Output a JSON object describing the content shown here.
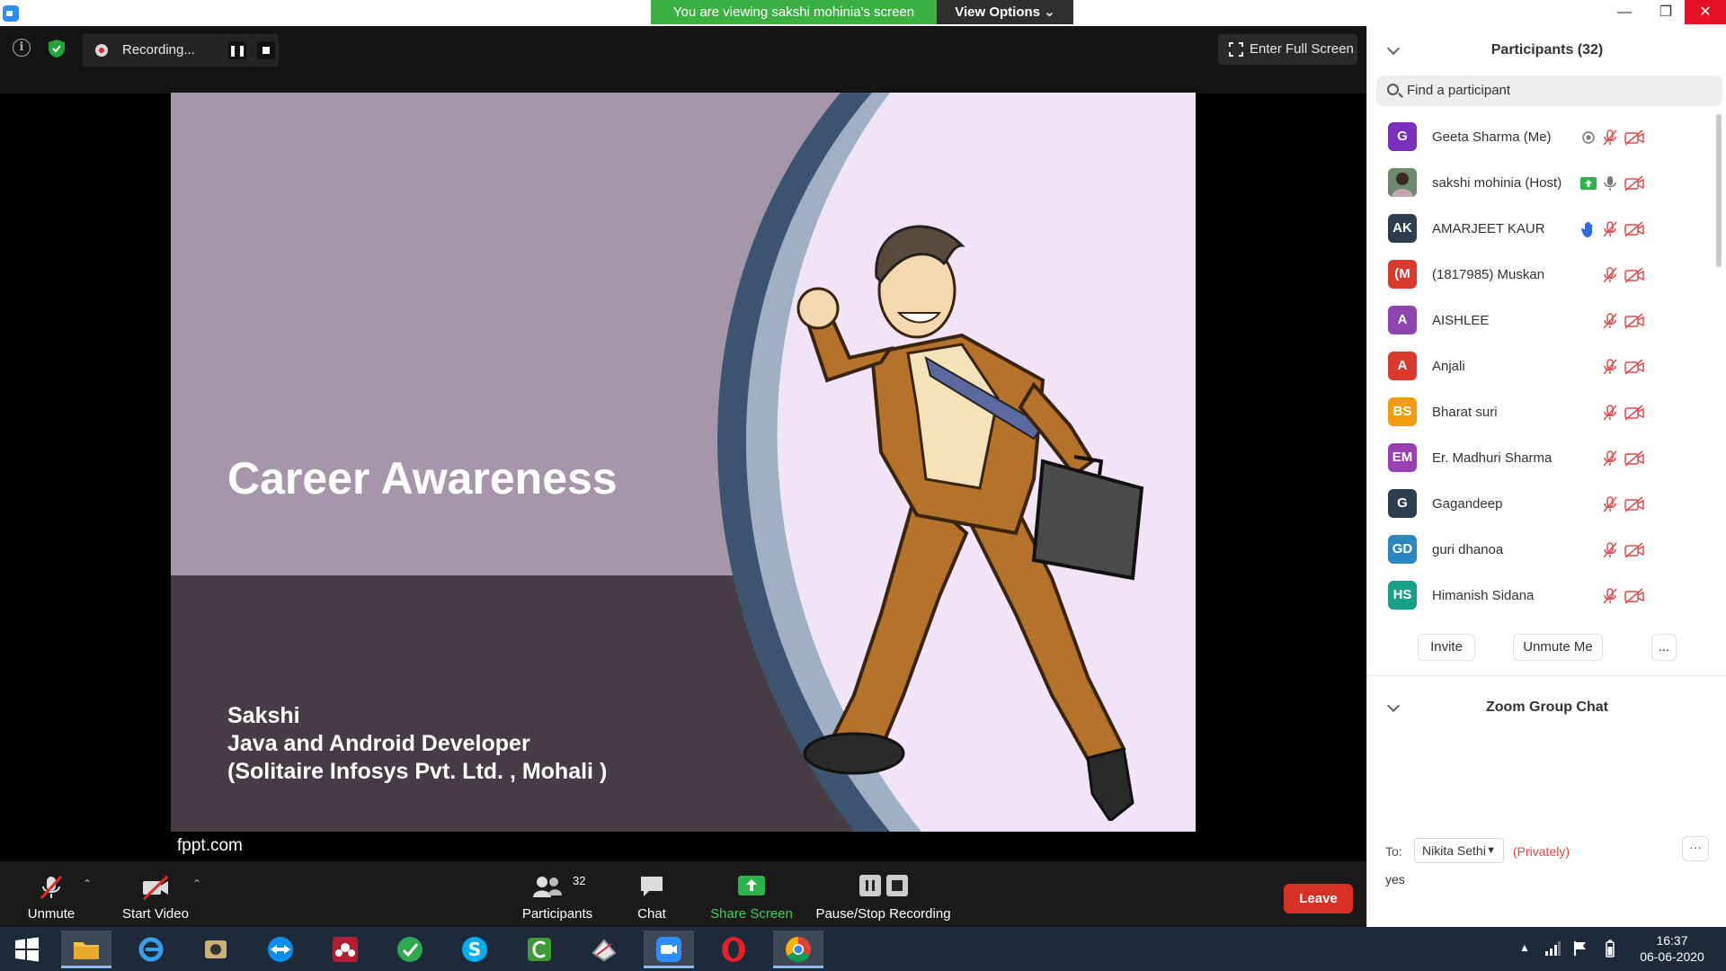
{
  "window": {
    "banner": "You are viewing sakshi mohinia's screen",
    "view_options": "View Options ⌄",
    "minimize_icon": "minimize-icon",
    "maximize_icon": "maximize-icon",
    "close_icon": "close-icon"
  },
  "meeting": {
    "recording_label": "Recording...",
    "fullscreen_label": "Enter Full Screen"
  },
  "slide": {
    "title": "Career Awareness",
    "author_lines": [
      "Sakshi",
      "Java and Android Developer",
      "(Solitaire Infosys Pvt. Ltd. , Mohali )"
    ],
    "footer": "fppt.com"
  },
  "toolbar": {
    "unmute": "Unmute",
    "start_video": "Start Video",
    "participants": "Participants",
    "participant_count": "32",
    "chat": "Chat",
    "share_screen": "Share Screen",
    "pause_stop": "Pause/Stop Recording",
    "leave": "Leave"
  },
  "panel": {
    "title": "Participants (32)",
    "search_placeholder": "Find a participant",
    "participants": [
      {
        "initials": "G",
        "name": "Geeta Sharma (Me)",
        "color": "#7b2fbe",
        "extra": "record"
      },
      {
        "initials": "",
        "name": "sakshi mohinia (Host)",
        "color": "#4a6b4f",
        "extra": "share"
      },
      {
        "initials": "AK",
        "name": "AMARJEET KAUR",
        "color": "#2d3e50",
        "extra": "hand"
      },
      {
        "initials": "(M",
        "name": "(1817985) Muskan",
        "color": "#d93a2b",
        "extra": ""
      },
      {
        "initials": "A",
        "name": "AISHLEE",
        "color": "#8e44ad",
        "extra": ""
      },
      {
        "initials": "A",
        "name": "Anjali",
        "color": "#d93a2b",
        "extra": ""
      },
      {
        "initials": "BS",
        "name": "Bharat suri",
        "color": "#f39c12",
        "extra": ""
      },
      {
        "initials": "EM",
        "name": "Er. Madhuri Sharma",
        "color": "#9b3fb5",
        "extra": ""
      },
      {
        "initials": "G",
        "name": "Gagandeep",
        "color": "#2d3e50",
        "extra": ""
      },
      {
        "initials": "GD",
        "name": "guri dhanoa",
        "color": "#2e86c1",
        "extra": ""
      },
      {
        "initials": "HS",
        "name": "Himanish Sidana",
        "color": "#16a085",
        "extra": ""
      }
    ],
    "invite": "Invite",
    "unmute_me": "Unmute Me",
    "more": "...",
    "chat_title": "Zoom Group Chat",
    "to_label": "To:",
    "to_recipient": "Nikita Sethi",
    "privately": "(Privately)",
    "chat_more": "···",
    "chat_input": "yes"
  },
  "taskbar": {
    "time": "16:37",
    "date": "06-06-2020"
  }
}
